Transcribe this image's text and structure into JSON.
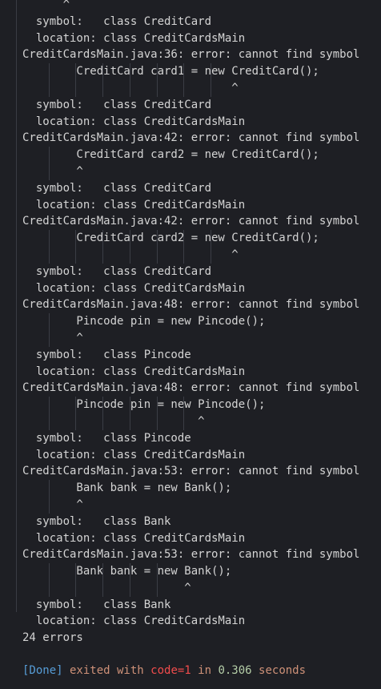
{
  "terminal": {
    "lines": [
      {
        "text": "      ^",
        "guides": []
      },
      {
        "text": "  symbol:   class CreditCard",
        "guides": []
      },
      {
        "text": "  location: class CreditCardsMain",
        "guides": []
      },
      {
        "text": "CreditCardsMain.java:36: error: cannot find symbol",
        "guides": []
      },
      {
        "text": "        CreditCard card1 = new CreditCard();",
        "guides": [
          1,
          2,
          3,
          4,
          5,
          6,
          7
        ]
      },
      {
        "text": "                               ^",
        "guides": [
          1,
          2,
          3,
          4,
          5,
          6,
          7
        ]
      },
      {
        "text": "  symbol:   class CreditCard",
        "guides": []
      },
      {
        "text": "  location: class CreditCardsMain",
        "guides": []
      },
      {
        "text": "CreditCardsMain.java:42: error: cannot find symbol",
        "guides": []
      },
      {
        "text": "        CreditCard card2 = new CreditCard();",
        "guides": [
          1
        ]
      },
      {
        "text": "        ^",
        "guides": [
          1
        ]
      },
      {
        "text": "  symbol:   class CreditCard",
        "guides": []
      },
      {
        "text": "  location: class CreditCardsMain",
        "guides": []
      },
      {
        "text": "CreditCardsMain.java:42: error: cannot find symbol",
        "guides": []
      },
      {
        "text": "        CreditCard card2 = new CreditCard();",
        "guides": [
          1,
          2,
          3,
          4,
          5,
          6,
          7
        ]
      },
      {
        "text": "                               ^",
        "guides": [
          1,
          2,
          3,
          4,
          5,
          6,
          7
        ]
      },
      {
        "text": "  symbol:   class CreditCard",
        "guides": []
      },
      {
        "text": "  location: class CreditCardsMain",
        "guides": []
      },
      {
        "text": "CreditCardsMain.java:48: error: cannot find symbol",
        "guides": []
      },
      {
        "text": "        Pincode pin = new Pincode();",
        "guides": [
          1
        ]
      },
      {
        "text": "        ^",
        "guides": [
          1
        ]
      },
      {
        "text": "  symbol:   class Pincode",
        "guides": []
      },
      {
        "text": "  location: class CreditCardsMain",
        "guides": []
      },
      {
        "text": "CreditCardsMain.java:48: error: cannot find symbol",
        "guides": []
      },
      {
        "text": "        Pincode pin = new Pincode();",
        "guides": [
          1,
          2,
          3,
          4,
          5,
          6
        ]
      },
      {
        "text": "                          ^",
        "guides": [
          1,
          2,
          3,
          4,
          5,
          6
        ]
      },
      {
        "text": "  symbol:   class Pincode",
        "guides": []
      },
      {
        "text": "  location: class CreditCardsMain",
        "guides": []
      },
      {
        "text": "CreditCardsMain.java:53: error: cannot find symbol",
        "guides": []
      },
      {
        "text": "        Bank bank = new Bank();",
        "guides": [
          1
        ]
      },
      {
        "text": "        ^",
        "guides": [
          1
        ]
      },
      {
        "text": "  symbol:   class Bank",
        "guides": []
      },
      {
        "text": "  location: class CreditCardsMain",
        "guides": []
      },
      {
        "text": "CreditCardsMain.java:53: error: cannot find symbol",
        "guides": []
      },
      {
        "text": "        Bank bank = new Bank();",
        "guides": [
          1,
          2,
          3,
          4,
          5
        ]
      },
      {
        "text": "                        ^",
        "guides": [
          1,
          2,
          3,
          4,
          5
        ]
      },
      {
        "text": "  symbol:   class Bank",
        "guides": []
      },
      {
        "text": "  location: class CreditCardsMain",
        "guides": []
      },
      {
        "text": "24 errors",
        "guides": []
      },
      {
        "text": "",
        "guides": []
      }
    ],
    "done": {
      "tag": "[Done]",
      "exited_text": " exited with ",
      "code": "code=1",
      "in_text": " in ",
      "time": "0.306",
      "seconds": " seconds"
    }
  },
  "colors": {
    "background": "#1e1f24",
    "text": "#d4d4d4",
    "done_tag": "#569cd6",
    "exit_text": "#ce9178",
    "exit_code": "#f14c4c",
    "time": "#b5cea8"
  }
}
